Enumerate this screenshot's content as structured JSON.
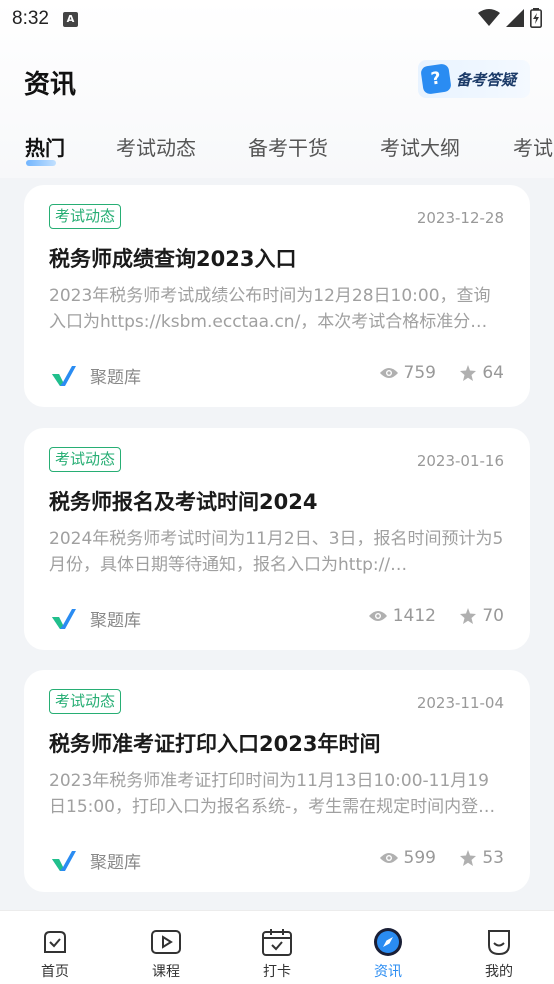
{
  "status": {
    "time": "8:32",
    "notif": "A"
  },
  "header": {
    "title": "资讯",
    "qa_button_label": "备考答疑",
    "qa_icon_glyph": "?"
  },
  "tabs": [
    {
      "label": "热门",
      "active": true
    },
    {
      "label": "考试动态"
    },
    {
      "label": "备考干货"
    },
    {
      "label": "考试大纲"
    },
    {
      "label": "考试"
    }
  ],
  "articles": [
    {
      "tag": "考试动态",
      "date": "2023-12-28",
      "title": "税务师成绩查询2023入口",
      "desc": "2023年税务师考试成绩公布时间为12月28日10:00，查询入口为https://ksbm.ecctaa.cn/，本次考试合格标准分…",
      "source": "聚题库",
      "views": "759",
      "stars": "64"
    },
    {
      "tag": "考试动态",
      "date": "2023-01-16",
      "title": "税务师报名及考试时间2024",
      "desc": "2024年税务师考试时间为11月2日、3日，报名时间预计为5月份，具体日期等待通知，报名入口为http://…",
      "source": "聚题库",
      "views": "1412",
      "stars": "70"
    },
    {
      "tag": "考试动态",
      "date": "2023-11-04",
      "title": "税务师准考证打印入口2023年时间",
      "desc": "2023年税务师准考证打印时间为11月13日10:00-11月19日15:00，打印入口为报名系统-，考生需在规定时间内登…",
      "source": "聚题库",
      "views": "599",
      "stars": "53"
    }
  ],
  "nav": [
    {
      "label": "首页",
      "icon": "home-icon"
    },
    {
      "label": "课程",
      "icon": "play-icon"
    },
    {
      "label": "打卡",
      "icon": "calendar-check-icon"
    },
    {
      "label": "资讯",
      "icon": "compass-icon",
      "active": true
    },
    {
      "label": "我的",
      "icon": "profile-icon"
    }
  ],
  "colors": {
    "accent": "#2a8cf2",
    "tag": "#27ae74"
  }
}
